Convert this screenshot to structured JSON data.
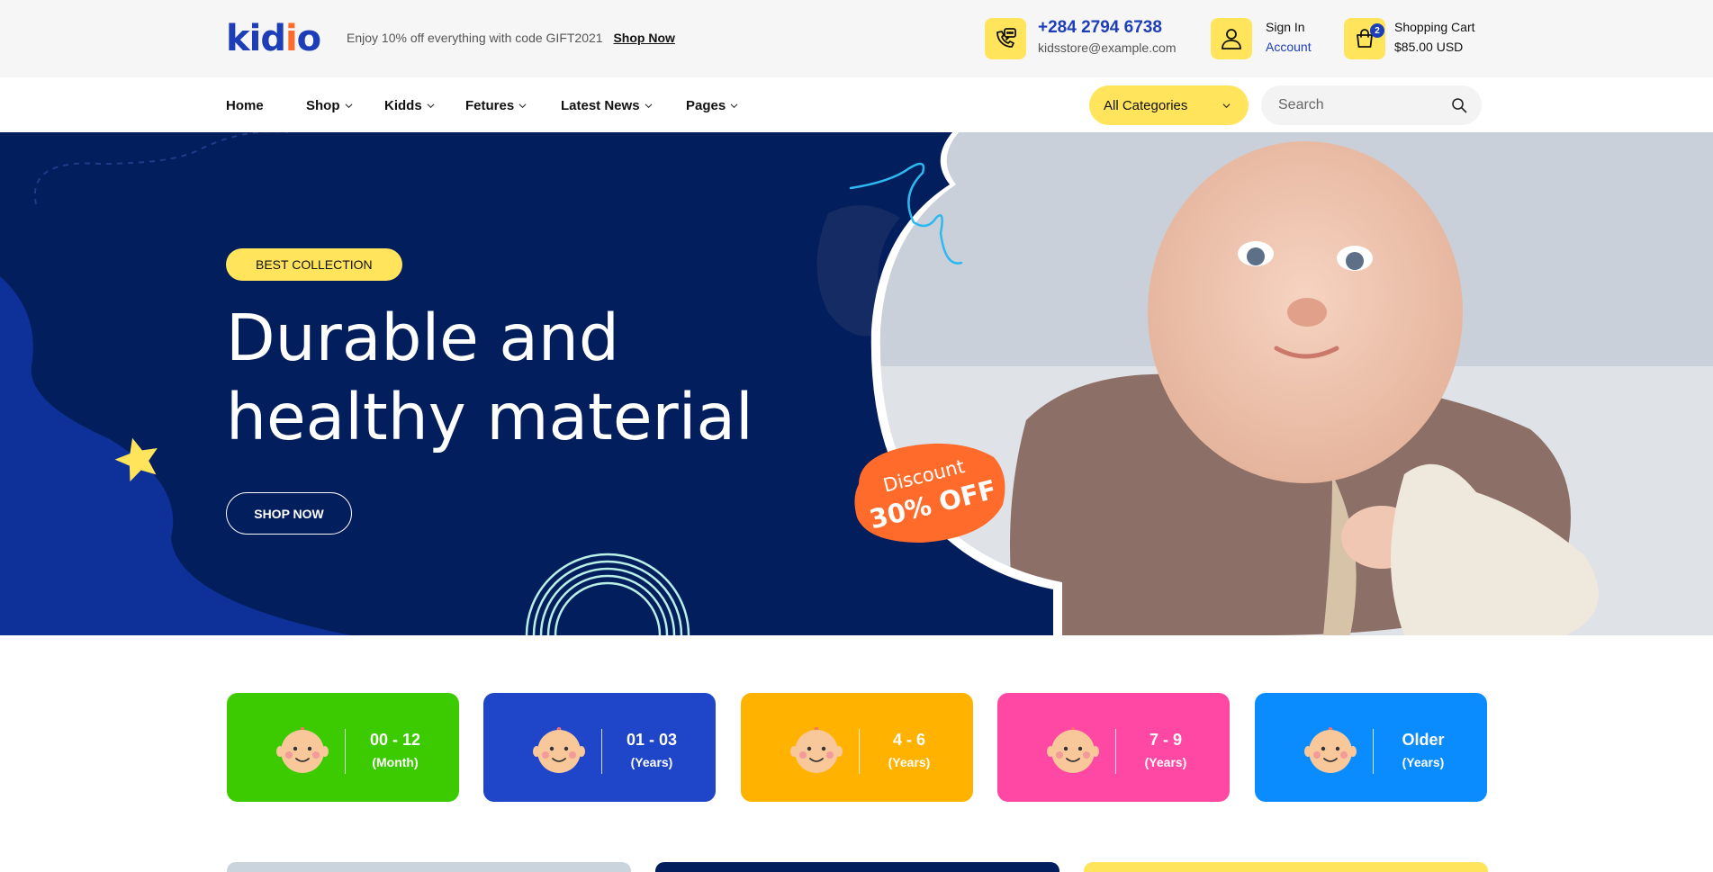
{
  "brand": {
    "logo_k": "kid",
    "logo_i": "i",
    "logo_o": "o"
  },
  "topbar": {
    "promo_text": "Enjoy 10% off everything with code GIFT2021",
    "promo_link": "Shop Now",
    "phone": "+284 2794 6738",
    "email": "kidsstore@example.com",
    "signin": "Sign In",
    "account": "Account",
    "cart_label": "Shopping Cart",
    "cart_total": "$85.00 USD",
    "cart_count": "2",
    "accent": "#ffe45c",
    "brand_blue": "#1e3eb8"
  },
  "nav": {
    "items": [
      "Home",
      "Shop",
      "Kidds",
      "Fetures",
      "Latest News",
      "Pages"
    ],
    "category_select": "All Categories",
    "search_placeholder": "Search"
  },
  "hero": {
    "pill": "BEST COLLECTION",
    "headline_line1": "Durable and",
    "headline_line2": "healthy material",
    "button": "SHOP NOW",
    "discount_line1": "Discount",
    "discount_line2": "30% OFF",
    "bg_color": "#031e5c"
  },
  "age_cards": [
    {
      "range": "00 - 12",
      "unit": "(Month)",
      "color": "#3ccb00"
    },
    {
      "range": "01 - 03",
      "unit": "(Years)",
      "color": "#1f45c9"
    },
    {
      "range": "4 - 6",
      "unit": "(Years)",
      "color": "#ffb200"
    },
    {
      "range": "7 - 9",
      "unit": "(Years)",
      "color": "#ff48a3"
    },
    {
      "range": "Older",
      "unit": "(Years)",
      "color": "#0a8cff"
    }
  ],
  "icons": [
    "phone-chat-icon",
    "user-icon",
    "shopping-bag-icon",
    "search-icon",
    "chevron-down-icon",
    "star-icon",
    "baby-face-icon"
  ]
}
